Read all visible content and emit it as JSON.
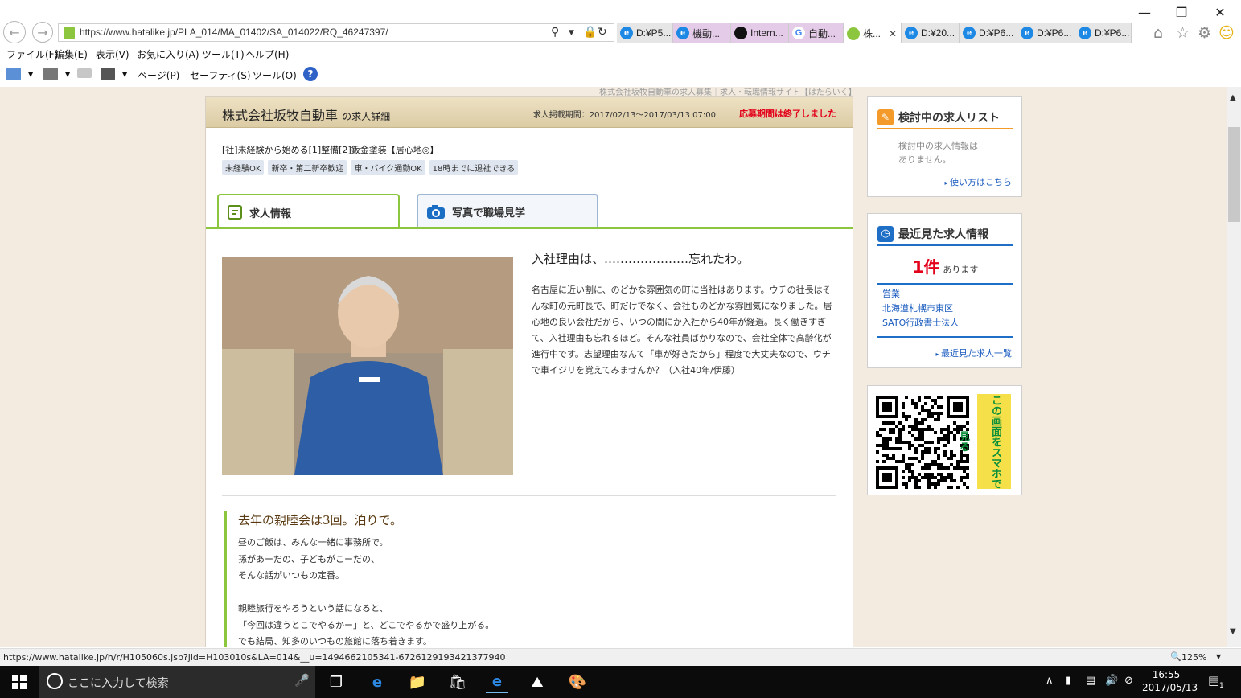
{
  "browser": {
    "url": "https://www.hatalike.jp/PLA_014/MA_01402/SA_014022/RQ_46247397/",
    "tabs": [
      {
        "label": "D:¥P5...",
        "type": "ie"
      },
      {
        "label": "機動...",
        "type": "ie"
      },
      {
        "label": "Intern...",
        "type": "museum"
      },
      {
        "label": "自動...",
        "type": "google"
      },
      {
        "label": "株...",
        "type": "hatalike",
        "active": true
      },
      {
        "label": "D:¥20...",
        "type": "ie"
      },
      {
        "label": "D:¥P6...",
        "type": "ie"
      },
      {
        "label": "D:¥P6...",
        "type": "ie"
      },
      {
        "label": "D:¥P6...",
        "type": "ie"
      }
    ],
    "menu": [
      "ファイル(F)",
      "編集(E)",
      "表示(V)",
      "お気に入り(A)",
      "ツール(T)",
      "ヘルプ(H)"
    ],
    "commands": [
      "ページ(P)",
      "セーフティ(S)",
      "ツール(O)"
    ],
    "status_url": "https://www.hatalike.jp/h/r/H105060s.jsp?jid=H103010s&LA=014&__u=1494662105341-6726129193421377940",
    "zoom": "125%"
  },
  "page": {
    "watermark": "株式会社坂牧自動車の求人募集｜求人・転職情報サイト【はたらいく】",
    "company": "株式会社坂牧自動車",
    "company_suffix": "の求人詳細",
    "period": "求人掲載期間：2017/02/13～2017/03/13 07:00",
    "ended": "応募期間は終了しました",
    "job_title": "[社]未経験から始める[1]整備[2]鈑金塗装【居心地◎】",
    "tags": [
      "未経験OK",
      "新卒・第二新卒歓迎",
      "車・バイク通勤OK",
      "18時までに退社できる"
    ],
    "tab_info": "求人情報",
    "tab_photo": "写真で職場見学",
    "section1": {
      "heading": "入社理由は、…………………忘れたわ。",
      "body": "名古屋に近い割に、のどかな雰囲気の町に当社はあります。ウチの社長はそんな町の元町長で、町だけでなく、会社ものどかな雰囲気になりました。居心地の良い会社だから、いつの間にか入社から40年が経過。長く働きすぎて、入社理由も忘れるほど。そんな社員ばかりなので、会社全体で高齢化が進行中です。志望理由なんて「車が好きだから」程度で大丈夫なので、ウチで車イジリを覚えてみませんか？（入社40年/伊藤）"
    },
    "section2": {
      "heading": "去年の親睦会は3回。泊りで。",
      "lines": [
        "昼のご飯は、みんな一緒に事務所で。",
        "孫があーだの、子どもがこーだの、",
        "そんな話がいつもの定番。",
        "",
        "親睦旅行をやろうという話になると、",
        "「今回は違うとこでやるかー」と、どこでやるかで盛り上がる。",
        "でも結局、知多のいつもの旅館に落ち着きます。"
      ]
    }
  },
  "sidebar": {
    "review": {
      "title": "検討中の求人リスト",
      "empty": [
        "検討中の求人情報は",
        "ありません。"
      ],
      "link": "使い方はこちら"
    },
    "recent": {
      "title": "最近見た求人情報",
      "count": "1件",
      "count_suffix": "あります",
      "items": [
        "営業",
        "北海道札幌市東区",
        "SATO行政書士法人"
      ],
      "link": "最近見た求人一覧"
    },
    "qr": {
      "label": "この画面をスマホで見る"
    }
  },
  "taskbar": {
    "search": "ここに入力して検索",
    "time": "16:55",
    "date": "2017/05/13",
    "notify": "1"
  }
}
